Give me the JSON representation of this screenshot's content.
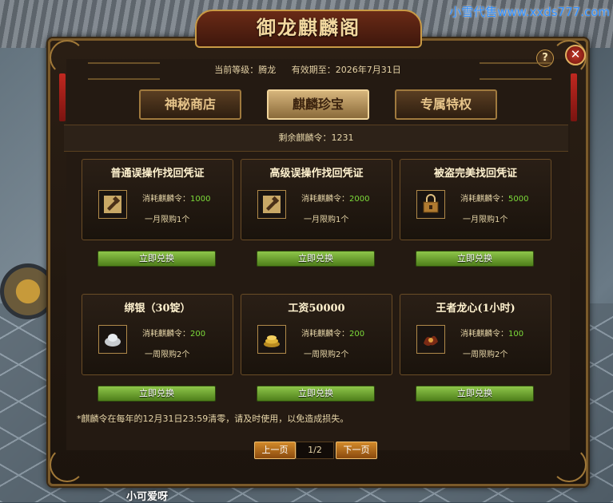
{
  "watermark": "小雪代售www.xxds777.com",
  "window": {
    "title": "御龙麒麟阁",
    "help_label": "?",
    "close_label": "✕"
  },
  "status": {
    "level": "当前等级：腾龙",
    "expiry": "有效期至：2026年7月31日"
  },
  "tabs": [
    {
      "label": "神秘商店",
      "active": false
    },
    {
      "label": "麒麟珍宝",
      "active": true
    },
    {
      "label": "专属特权",
      "active": false
    }
  ],
  "remaining": "剩余麒麟令：1231",
  "cost_prefix": "消耗麒麟令：",
  "items": [
    {
      "name": "普通误操作找回凭证",
      "cost": "1000",
      "limit": "一月限购1个",
      "icon": "hammer-scroll-icon",
      "button": "立即兑换"
    },
    {
      "name": "高级误操作找回凭证",
      "cost": "2000",
      "limit": "一月限购1个",
      "icon": "hammer-scroll-icon",
      "button": "立即兑换"
    },
    {
      "name": "被盗完美找回凭证",
      "cost": "5000",
      "limit": "一月限购1个",
      "icon": "lock-chest-icon",
      "button": "立即兑换"
    },
    {
      "name": "绑银（30锭）",
      "cost": "200",
      "limit": "一周限购2个",
      "icon": "silver-ingot-icon",
      "button": "立即兑换"
    },
    {
      "name": "工资50000",
      "cost": "200",
      "limit": "一周限购2个",
      "icon": "gold-coins-icon",
      "button": "立即兑换"
    },
    {
      "name": "王者龙心(1小时)",
      "cost": "100",
      "limit": "一周限购2个",
      "icon": "dragon-heart-icon",
      "button": "立即兑换"
    }
  ],
  "note": "*麒麟令在每年的12月31日23:59清零，请及时使用，以免造成损失。",
  "pager": {
    "prev": "上一页",
    "page": "1/2",
    "next": "下一页"
  },
  "player_name": "小可爱呀",
  "colors": {
    "accent_gold": "#c89a45",
    "cost_green": "#7ddc3a",
    "buy_button": "#6ea232",
    "close_red": "#c63a2a"
  }
}
